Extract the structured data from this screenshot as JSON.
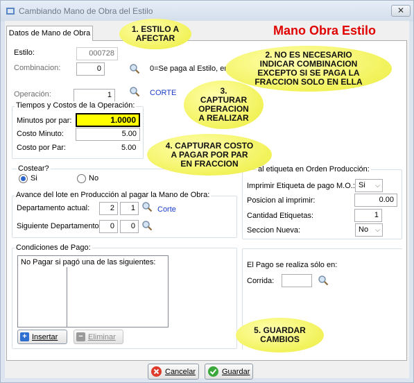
{
  "window": {
    "title": "Cambiando Mano de Obra del Estilo",
    "close_label": "✕"
  },
  "tab": {
    "label": "Datos de Mano de Obra"
  },
  "header": {
    "banner": "Mano Obra Estilo",
    "banner_color": "#e00000"
  },
  "estilo": {
    "label": "Estilo:",
    "value": "000728"
  },
  "combinacion": {
    "label": "Combinacion:",
    "value": "0",
    "hint": "0=Se paga al Estilo, en caso"
  },
  "operacion": {
    "label": "Operación:",
    "value": "1",
    "name": "CORTE"
  },
  "tiempos": {
    "title": "Tiempos y Costos de la Operación:",
    "minutos_label": "Minutos por par:",
    "minutos_value": "1.0000",
    "costo_minuto_label": "Costo Minuto:",
    "costo_minuto_value": "5.00",
    "costo_par_label": "Costo por Par:",
    "costo_par_value": "5.00"
  },
  "costear": {
    "title": "Costear?",
    "si": "Si",
    "no": "No",
    "selected": "Si"
  },
  "avance": {
    "title": "Avance del lote en Producción al pagar la Mano de Obra:",
    "depto_actual_label": "Departamento actual:",
    "depto_actual_a": "2",
    "depto_actual_b": "1",
    "depto_actual_name": "Corte",
    "siguiente_label": "Siguiente Departamento:",
    "siguiente_a": "0",
    "siguiente_b": "0"
  },
  "etiqueta": {
    "title": "al etiqueta en Orden Producción:",
    "imprimir_label": "Imprimir Etiqueta de pago M.O.:",
    "imprimir_value": "Si",
    "posicion_label": "Posicion al imprimir:",
    "posicion_value": "0.00",
    "cantidad_label": "Cantidad Etiquetas:",
    "cantidad_value": "1",
    "seccion_label": "Seccion Nueva:",
    "seccion_value": "No"
  },
  "condiciones": {
    "title": "Condiciones de Pago:",
    "list_header": "No Pagar si pagó una de las siguientes:"
  },
  "pago": {
    "label": "El Pago se realiza sólo en:",
    "corrida_label": "Corrida:",
    "corrida_value": ""
  },
  "buttons": {
    "insertar": "Insertar",
    "eliminar": "Eliminar",
    "cancelar": "Cancelar",
    "guardar": "Guardar"
  },
  "callouts": {
    "c1": "1. ESTILO A AFECTAR",
    "c2": "2. NO ES NECESARIO INDICAR COMBINACION EXCEPTO SI SE PAGA LA FRACCION SOLO EN ELLA",
    "c3": "3. CAPTURAR OPERACION A REALIZAR",
    "c4": "4. CAPTURAR COSTO A PAGAR POR PAR EN FRACCION",
    "c5": "5. GUARDAR CAMBIOS"
  },
  "colors": {
    "highlight_field": "#ffff00",
    "operation_name": "#1a3cc8",
    "callout": "#f4f45e"
  }
}
